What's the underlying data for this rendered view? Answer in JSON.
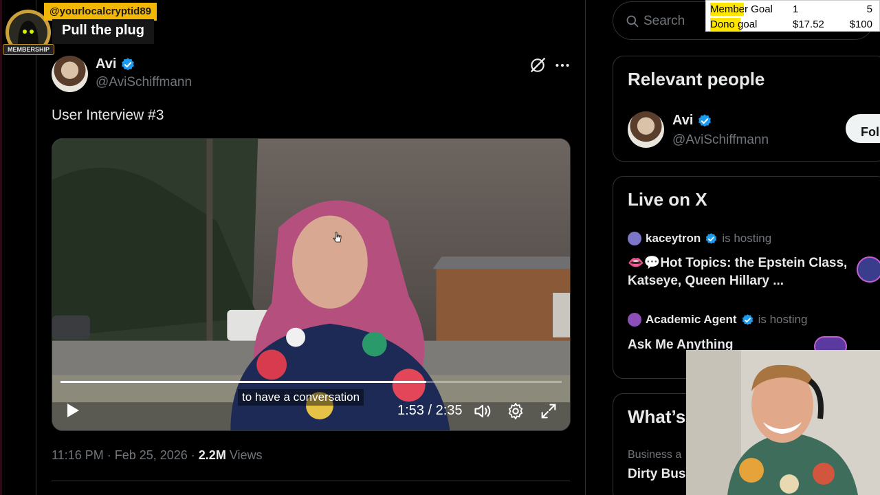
{
  "stream_overlay": {
    "username": "@yourlocalcryptid89",
    "title": "Pull the plug",
    "membership_label": "MEMBERSHIP"
  },
  "goals": {
    "member": {
      "label": "Member Goal",
      "current": "1",
      "target": "5",
      "progress": 0.2
    },
    "dono": {
      "label": "Dono goal",
      "current": "$17.52",
      "target": "$100",
      "progress": 0.18
    }
  },
  "post": {
    "author_name": "Avi",
    "author_handle": "@AviSchiffmann",
    "text": "User Interview #3",
    "timestamp": "11:16 PM · Feb 25, 2026 · ",
    "views_count": "2.2M",
    "views_label": " Views"
  },
  "video": {
    "caption": "to have a conversation",
    "time": "1:53 / 2:35",
    "progress": 0.73
  },
  "search": {
    "placeholder": "Search"
  },
  "relevant_people": {
    "title": "Relevant people",
    "name": "Avi",
    "handle": "@AviSchiffmann",
    "follow_label": "Fol"
  },
  "live": {
    "title": "Live on X",
    "spaces": [
      {
        "host": "kaceytron",
        "suffix": "is hosting",
        "title": "👄💬Hot Topics: the Epstein Class, Katseye, Queen Hillary ..."
      },
      {
        "host": "Academic Agent",
        "suffix": "is hosting",
        "title": "Ask Me Anything"
      }
    ]
  },
  "trends": {
    "title": "What’s",
    "category": "Business a",
    "name": "Dirty Bus"
  },
  "colors": {
    "accent": "#1d9bf0",
    "background": "#000000",
    "border": "#2f3336",
    "muted": "#71767b",
    "overlay_yellow": "#f2b705",
    "goal_highlight": "#ffe600"
  }
}
